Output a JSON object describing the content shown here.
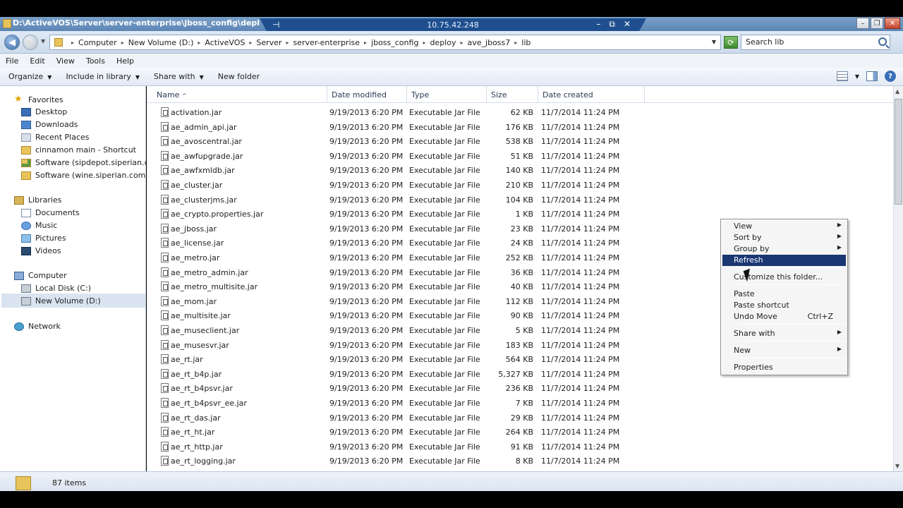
{
  "window": {
    "title": "D:\\ActiveVOS\\Server\\server-enterprise\\jboss_config\\deploy\\av",
    "minimize": "–",
    "restore": "❐",
    "close": "✕"
  },
  "rdp": {
    "ip": "10.75.42.248",
    "pin": "⊣",
    "minimize": "–",
    "restore": "⧉",
    "close": "✕"
  },
  "address": {
    "breadcrumbs": [
      "Computer",
      "New Volume (D:)",
      "ActiveVOS",
      "Server",
      "server-enterprise",
      "jboss_config",
      "deploy",
      "ave_jboss7",
      "lib"
    ],
    "search_placeholder": "Search lib"
  },
  "menu": [
    "File",
    "Edit",
    "View",
    "Tools",
    "Help"
  ],
  "commands": {
    "organize": "Organize",
    "include": "Include in library",
    "share": "Share with",
    "new_folder": "New folder"
  },
  "nav": {
    "favorites": "Favorites",
    "desktop": "Desktop",
    "downloads": "Downloads",
    "recent": "Recent Places",
    "cinnamon": "cinnamon main - Shortcut",
    "sw1": "Software (sipdepot.siperian.com)",
    "sw2": "Software (wine.siperian.com)",
    "libraries": "Libraries",
    "documents": "Documents",
    "music": "Music",
    "pictures": "Pictures",
    "videos": "Videos",
    "computer": "Computer",
    "localc": "Local Disk (C:)",
    "newvol": "New Volume (D:)",
    "network": "Network"
  },
  "columns": {
    "name": "Name",
    "date": "Date modified",
    "type": "Type",
    "size": "Size",
    "created": "Date created",
    "sort": "^"
  },
  "files": [
    {
      "name": "activation.jar",
      "date": "9/19/2013 6:20 PM",
      "type": "Executable Jar File",
      "size": "62 KB",
      "created": "11/7/2014 11:24 PM"
    },
    {
      "name": "ae_admin_api.jar",
      "date": "9/19/2013 6:20 PM",
      "type": "Executable Jar File",
      "size": "176 KB",
      "created": "11/7/2014 11:24 PM"
    },
    {
      "name": "ae_avoscentral.jar",
      "date": "9/19/2013 6:20 PM",
      "type": "Executable Jar File",
      "size": "538 KB",
      "created": "11/7/2014 11:24 PM"
    },
    {
      "name": "ae_awfupgrade.jar",
      "date": "9/19/2013 6:20 PM",
      "type": "Executable Jar File",
      "size": "51 KB",
      "created": "11/7/2014 11:24 PM"
    },
    {
      "name": "ae_awfxmldb.jar",
      "date": "9/19/2013 6:20 PM",
      "type": "Executable Jar File",
      "size": "140 KB",
      "created": "11/7/2014 11:24 PM"
    },
    {
      "name": "ae_cluster.jar",
      "date": "9/19/2013 6:20 PM",
      "type": "Executable Jar File",
      "size": "210 KB",
      "created": "11/7/2014 11:24 PM"
    },
    {
      "name": "ae_clusterjms.jar",
      "date": "9/19/2013 6:20 PM",
      "type": "Executable Jar File",
      "size": "104 KB",
      "created": "11/7/2014 11:24 PM"
    },
    {
      "name": "ae_crypto.properties.jar",
      "date": "9/19/2013 6:20 PM",
      "type": "Executable Jar File",
      "size": "1 KB",
      "created": "11/7/2014 11:24 PM"
    },
    {
      "name": "ae_jboss.jar",
      "date": "9/19/2013 6:20 PM",
      "type": "Executable Jar File",
      "size": "23 KB",
      "created": "11/7/2014 11:24 PM"
    },
    {
      "name": "ae_license.jar",
      "date": "9/19/2013 6:20 PM",
      "type": "Executable Jar File",
      "size": "24 KB",
      "created": "11/7/2014 11:24 PM"
    },
    {
      "name": "ae_metro.jar",
      "date": "9/19/2013 6:20 PM",
      "type": "Executable Jar File",
      "size": "252 KB",
      "created": "11/7/2014 11:24 PM"
    },
    {
      "name": "ae_metro_admin.jar",
      "date": "9/19/2013 6:20 PM",
      "type": "Executable Jar File",
      "size": "36 KB",
      "created": "11/7/2014 11:24 PM"
    },
    {
      "name": "ae_metro_multisite.jar",
      "date": "9/19/2013 6:20 PM",
      "type": "Executable Jar File",
      "size": "40 KB",
      "created": "11/7/2014 11:24 PM"
    },
    {
      "name": "ae_mom.jar",
      "date": "9/19/2013 6:20 PM",
      "type": "Executable Jar File",
      "size": "112 KB",
      "created": "11/7/2014 11:24 PM"
    },
    {
      "name": "ae_multisite.jar",
      "date": "9/19/2013 6:20 PM",
      "type": "Executable Jar File",
      "size": "90 KB",
      "created": "11/7/2014 11:24 PM"
    },
    {
      "name": "ae_museclient.jar",
      "date": "9/19/2013 6:20 PM",
      "type": "Executable Jar File",
      "size": "5 KB",
      "created": "11/7/2014 11:24 PM"
    },
    {
      "name": "ae_musesvr.jar",
      "date": "9/19/2013 6:20 PM",
      "type": "Executable Jar File",
      "size": "183 KB",
      "created": "11/7/2014 11:24 PM"
    },
    {
      "name": "ae_rt.jar",
      "date": "9/19/2013 6:20 PM",
      "type": "Executable Jar File",
      "size": "564 KB",
      "created": "11/7/2014 11:24 PM"
    },
    {
      "name": "ae_rt_b4p.jar",
      "date": "9/19/2013 6:20 PM",
      "type": "Executable Jar File",
      "size": "5,327 KB",
      "created": "11/7/2014 11:24 PM"
    },
    {
      "name": "ae_rt_b4psvr.jar",
      "date": "9/19/2013 6:20 PM",
      "type": "Executable Jar File",
      "size": "236 KB",
      "created": "11/7/2014 11:24 PM"
    },
    {
      "name": "ae_rt_b4psvr_ee.jar",
      "date": "9/19/2013 6:20 PM",
      "type": "Executable Jar File",
      "size": "7 KB",
      "created": "11/7/2014 11:24 PM"
    },
    {
      "name": "ae_rt_das.jar",
      "date": "9/19/2013 6:20 PM",
      "type": "Executable Jar File",
      "size": "29 KB",
      "created": "11/7/2014 11:24 PM"
    },
    {
      "name": "ae_rt_ht.jar",
      "date": "9/19/2013 6:20 PM",
      "type": "Executable Jar File",
      "size": "264 KB",
      "created": "11/7/2014 11:24 PM"
    },
    {
      "name": "ae_rt_http.jar",
      "date": "9/19/2013 6:20 PM",
      "type": "Executable Jar File",
      "size": "91 KB",
      "created": "11/7/2014 11:24 PM"
    },
    {
      "name": "ae_rt_logging.jar",
      "date": "9/19/2013 6:20 PM",
      "type": "Executable Jar File",
      "size": "8 KB",
      "created": "11/7/2014 11:24 PM"
    }
  ],
  "status": {
    "count": "87 items"
  },
  "context_menu": {
    "view": "View",
    "sortby": "Sort by",
    "groupby": "Group by",
    "refresh": "Refresh",
    "customize": "Customize this folder...",
    "paste": "Paste",
    "paste_shortcut": "Paste shortcut",
    "undo_move": "Undo Move",
    "undo_shortcut": "Ctrl+Z",
    "share_with": "Share with",
    "new": "New",
    "properties": "Properties",
    "submenu_arrow": "▶"
  },
  "colors": {
    "highlight": "#1a3673",
    "titlebar": "#6a92bf",
    "selection": "#d9e4f0"
  }
}
